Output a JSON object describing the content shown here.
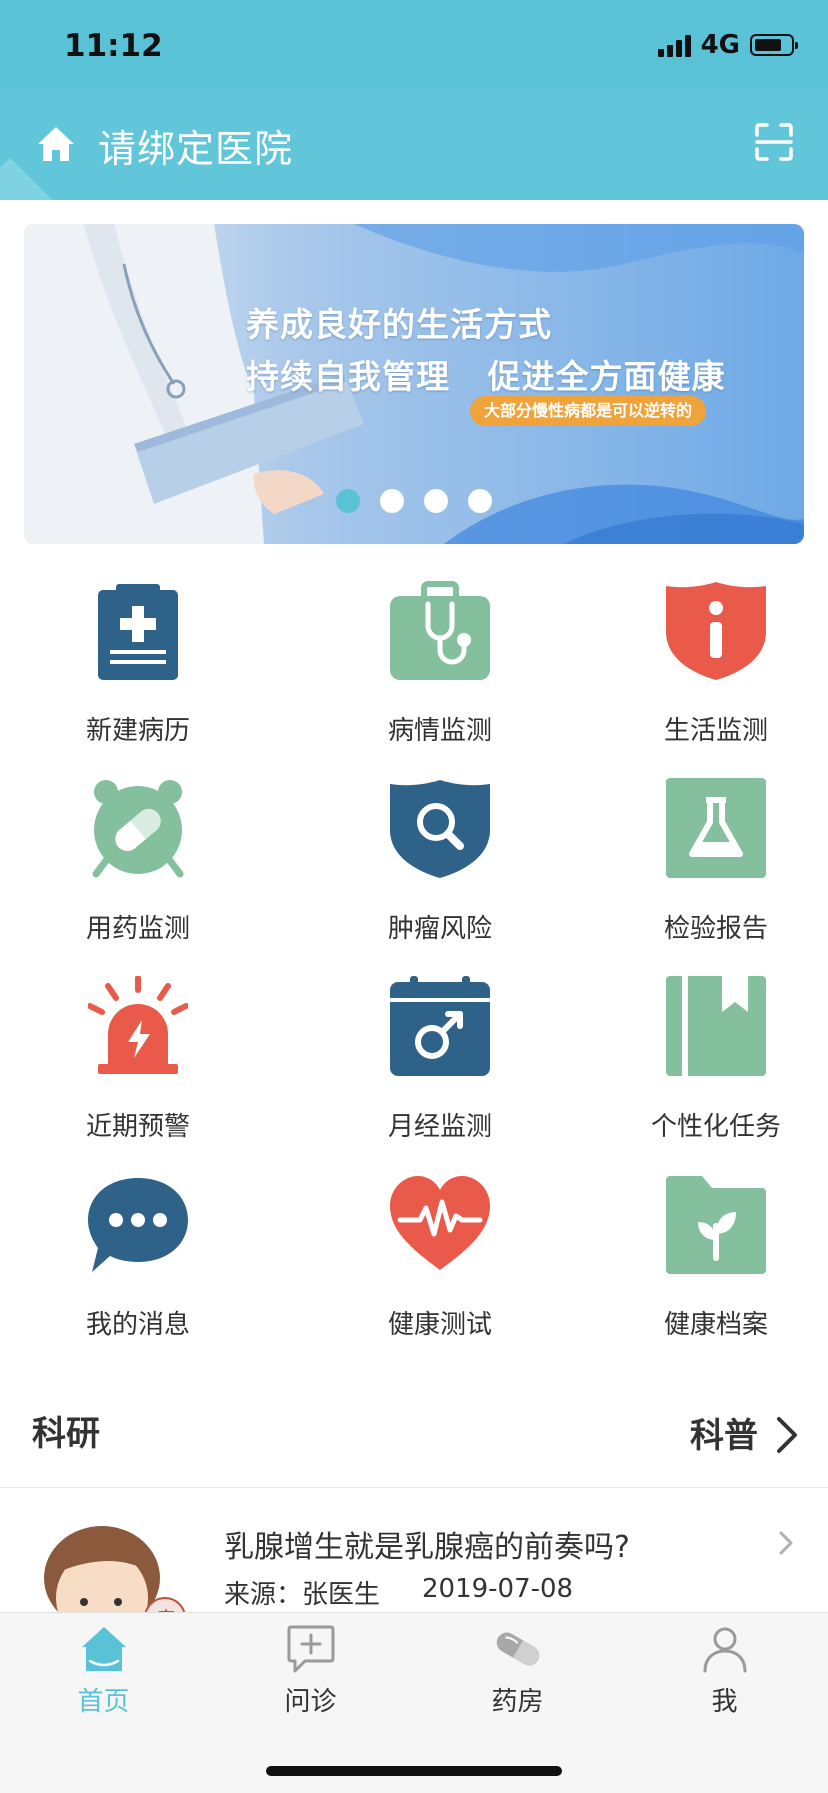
{
  "status": {
    "time": "11:12",
    "network": "4G"
  },
  "header": {
    "title": "请绑定医院"
  },
  "banner": {
    "line1": "养成良好的生活方式",
    "line2": "持续自我管理   促进全方面健康",
    "tag": "大部分慢性病都是可以逆转的",
    "dots": 4,
    "active_dot": 1
  },
  "grid": [
    {
      "label": "新建病历",
      "icon": "medical-record-icon"
    },
    {
      "label": "病情监测",
      "icon": "stethoscope-icon"
    },
    {
      "label": "生活监测",
      "icon": "info-shield-icon"
    },
    {
      "label": "用药监测",
      "icon": "pill-alarm-icon"
    },
    {
      "label": "肿瘤风险",
      "icon": "search-shield-icon"
    },
    {
      "label": "检验报告",
      "icon": "flask-icon"
    },
    {
      "label": "近期预警",
      "icon": "siren-icon"
    },
    {
      "label": "月经监测",
      "icon": "calendar-gender-icon"
    },
    {
      "label": "个性化任务",
      "icon": "book-icon"
    },
    {
      "label": "我的消息",
      "icon": "chat-bubble-icon"
    },
    {
      "label": "健康测试",
      "icon": "heart-pulse-icon"
    },
    {
      "label": "健康档案",
      "icon": "folder-plant-icon"
    }
  ],
  "section": {
    "left": "科研",
    "right": "科普"
  },
  "article": {
    "title": "乳腺增生就是乳腺癌的前奏吗?",
    "source": "来源：张医生",
    "date": "2019-07-08",
    "avatar_stamp": "痛"
  },
  "tabs": [
    {
      "label": "首页",
      "icon": "home-icon",
      "active": true
    },
    {
      "label": "问诊",
      "icon": "consult-icon",
      "active": false
    },
    {
      "label": "药房",
      "icon": "capsule-icon",
      "active": false
    },
    {
      "label": "我",
      "icon": "user-icon",
      "active": false
    }
  ],
  "colors": {
    "primary": "#59c2d6",
    "navy": "#2f6289",
    "green": "#84bf9e",
    "red": "#ea5a4a",
    "orange": "#f0a33a"
  }
}
